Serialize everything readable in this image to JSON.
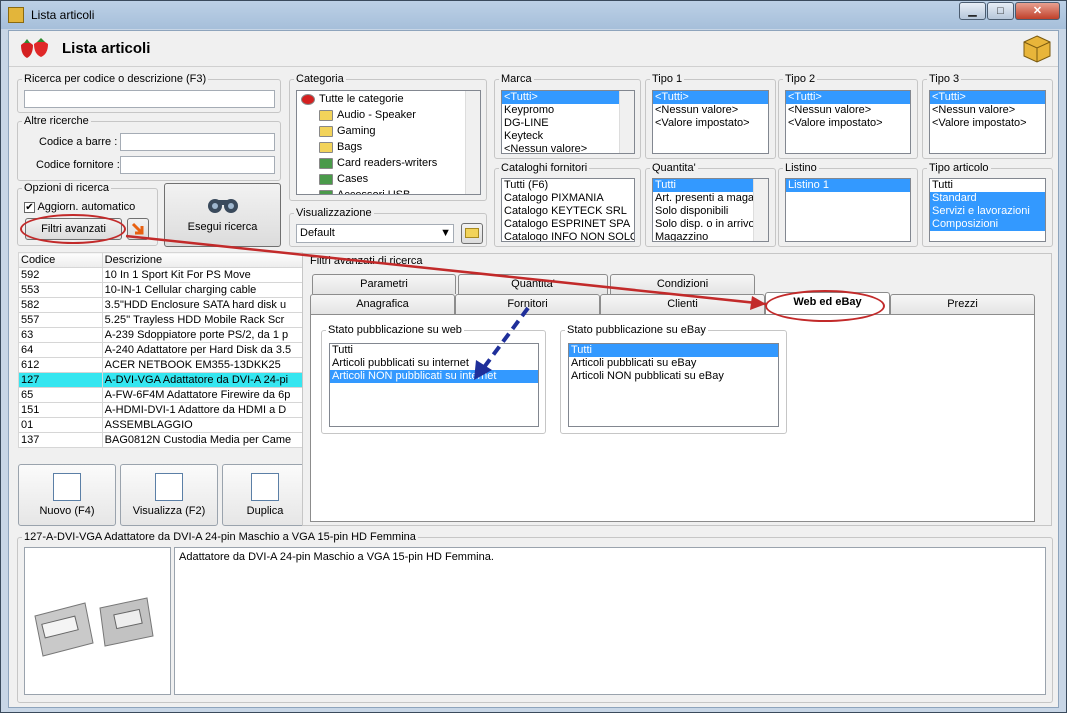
{
  "window": {
    "title": "Lista articoli",
    "min": "▁",
    "max": "□",
    "close": "✕"
  },
  "header": {
    "title": "Lista articoli"
  },
  "search": {
    "legend": "Ricerca per codice o descrizione (F3)",
    "value": ""
  },
  "altre": {
    "legend": "Altre ricerche",
    "barcode_label": "Codice a barre :",
    "barcode_value": "",
    "supplier_label": "Codice fornitore :",
    "supplier_value": ""
  },
  "opzioni": {
    "legend": "Opzioni di ricerca",
    "auto_label": "Aggiorn. automatico",
    "auto_checked": "✔",
    "advanced_button": "Filtri avanzati"
  },
  "esegui": {
    "label": "Esegui ricerca"
  },
  "categoria": {
    "legend": "Categoria",
    "items": [
      "Tutte le categorie",
      "Audio - Speaker",
      "Gaming",
      "Bags",
      "Card readers-writers",
      "Cases",
      "Accessori USB"
    ]
  },
  "visualizzazione": {
    "legend": "Visualizzazione",
    "value": "Default"
  },
  "marca": {
    "legend": "Marca",
    "items": [
      "<Tutti>",
      "Keypromo",
      "DG-LINE",
      "Keyteck",
      "<Nessun valore>"
    ]
  },
  "tipo1": {
    "legend": "Tipo 1",
    "items": [
      "<Tutti>",
      "<Nessun valore>",
      "<Valore impostato>"
    ]
  },
  "tipo2": {
    "legend": "Tipo 2",
    "items": [
      "<Tutti>",
      "<Nessun valore>",
      "<Valore impostato>"
    ]
  },
  "tipo3": {
    "legend": "Tipo 3",
    "items": [
      "<Tutti>",
      "<Nessun valore>",
      "<Valore impostato>"
    ]
  },
  "cataloghi": {
    "legend": "Cataloghi fornitori",
    "items": [
      "Tutti (F6)",
      "Catalogo PIXMANIA",
      "Catalogo KEYTECK SRL",
      "Catalogo ESPRINET SPA",
      "Catalogo INFO NON SOLO"
    ]
  },
  "quantita": {
    "legend": "Quantita'",
    "items": [
      "Tutti",
      "Art. presenti a magazzino",
      "Solo disponibili",
      "Solo disp. o in arrivo",
      "Magazzino"
    ]
  },
  "listino": {
    "legend": "Listino",
    "items": [
      "Listino 1"
    ]
  },
  "tipoart": {
    "legend": "Tipo articolo",
    "items": [
      "Tutti",
      "Standard",
      "Servizi e lavorazioni",
      "Composizioni"
    ]
  },
  "grid": {
    "columns": [
      "Codice",
      "Descrizione"
    ],
    "rows": [
      [
        "592",
        "10 In 1 Sport Kit For PS Move"
      ],
      [
        "553",
        "10-IN-1 Cellular charging cable"
      ],
      [
        "582",
        "3.5\"HDD Enclosure SATA hard disk u"
      ],
      [
        "557",
        "5.25'' Trayless HDD Mobile Rack Scr"
      ],
      [
        "63",
        "A-239 Sdoppiatore porte PS/2, da 1 p"
      ],
      [
        "64",
        "A-240 Adattatore per Hard Disk da 3.5"
      ],
      [
        "612",
        "ACER NETBOOK EM355-13DKK25"
      ],
      [
        "127",
        "A-DVI-VGA Adattatore da DVI-A 24-pi"
      ],
      [
        "65",
        "A-FW-6F4M Adattatore Firewire da 6p"
      ],
      [
        "151",
        "A-HDMI-DVI-1 Adattore da HDMI a D"
      ],
      [
        "01",
        "ASSEMBLAGGIO"
      ],
      [
        "137",
        "BAG0812N Custodia Media per Came"
      ]
    ]
  },
  "toolbar": {
    "nuovo": "Nuovo (F4)",
    "visualizza": "Visualizza (F2)",
    "duplica": "Duplica"
  },
  "filtri": {
    "title": "Filtri avanzati di ricerca",
    "tabs_row1": [
      "Parametri",
      "Quantita'",
      "Condizioni"
    ],
    "tabs_row2": [
      "Anagrafica",
      "Fornitori",
      "Clienti",
      "Web ed eBay",
      "Prezzi"
    ],
    "web_legend": "Stato pubblicazione su web",
    "web_items": [
      "Tutti",
      "Articoli pubblicati su internet",
      "Articoli NON pubblicati su internet"
    ],
    "ebay_legend": "Stato pubblicazione su eBay",
    "ebay_items": [
      "Tutti",
      "Articoli pubblicati su eBay",
      "Articoli NON pubblicati su eBay"
    ]
  },
  "detail": {
    "legend": "127-A-DVI-VGA Adattatore da DVI-A 24-pin Maschio a VGA 15-pin HD Femmina",
    "description": "Adattatore da DVI-A 24-pin Maschio a VGA 15-pin HD Femmina."
  },
  "colors": {
    "selection": "#3399ff",
    "highlight_row": "#35e6f0",
    "annotation": "#c22a2a",
    "arrow_blue": "#1f2f9a"
  }
}
